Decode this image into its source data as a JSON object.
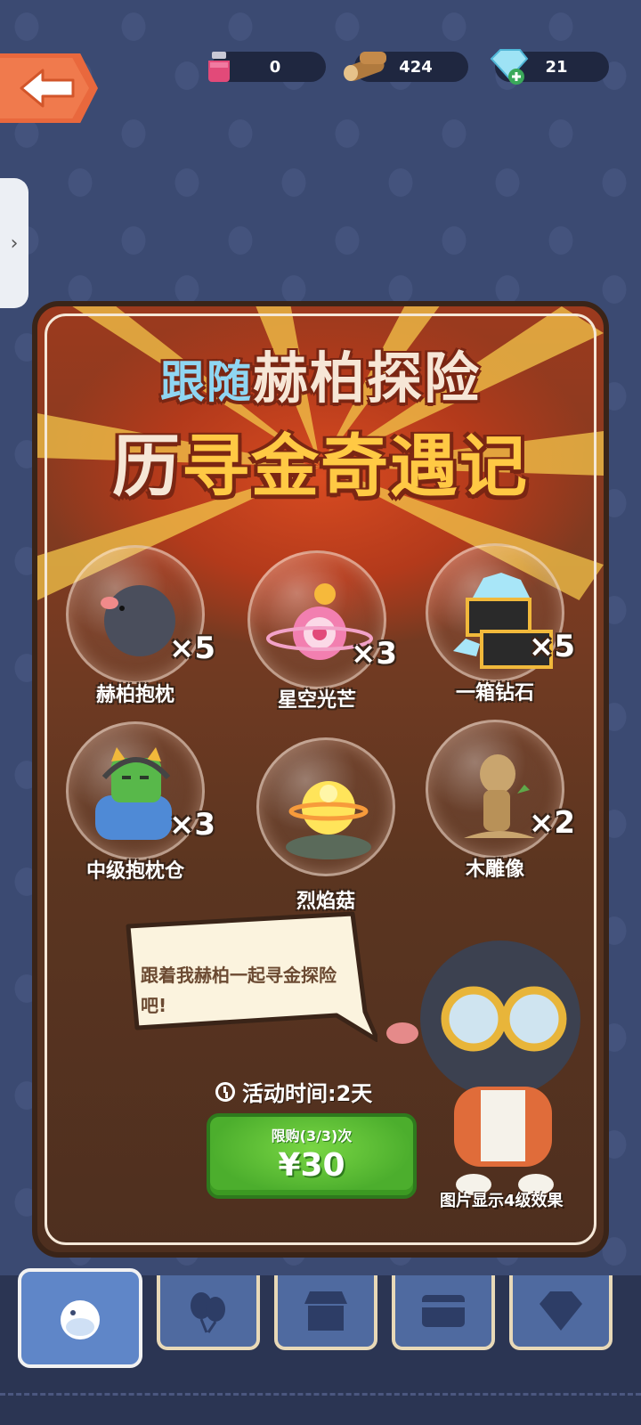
{
  "resources": [
    {
      "icon": "potion-icon",
      "value": "0"
    },
    {
      "icon": "wood-icon",
      "value": "424"
    },
    {
      "icon": "diamond-icon",
      "value": "21"
    }
  ],
  "side_tab": {
    "arrow": "›"
  },
  "banner": {
    "title_line1_blue": "跟随",
    "title_line1": "赫柏探险",
    "title_line2_light": "历",
    "title_line2": "寻金奇遇记"
  },
  "rewards": [
    {
      "name": "赫柏抱枕",
      "qty": "×5",
      "icon": "mole-pillow-icon"
    },
    {
      "name": "星空光芒",
      "qty": "×3",
      "icon": "star-light-icon"
    },
    {
      "name": "一箱钻石",
      "qty": "×5",
      "icon": "diamond-box-icon"
    },
    {
      "name": "中级抱枕仓",
      "qty": "×3",
      "icon": "pillow-pod-icon"
    },
    {
      "name": "烈焰菇",
      "qty": "",
      "icon": "flame-mushroom-icon"
    },
    {
      "name": "木雕像",
      "qty": "×2",
      "icon": "wood-statue-icon"
    }
  ],
  "speech": {
    "text": "跟着我赫柏一起寻金探险吧!"
  },
  "timer": {
    "label": "活动时间:2天"
  },
  "purchase": {
    "limit": "限购(3/3)次",
    "price": "¥30"
  },
  "note": "图片显示4级效果",
  "tabs": [
    {
      "icon": "character-icon",
      "active": true
    },
    {
      "icon": "balloons-icon",
      "active": false
    },
    {
      "icon": "shop-icon",
      "active": false
    },
    {
      "icon": "card-icon",
      "active": false
    },
    {
      "icon": "gem-icon",
      "active": false
    }
  ],
  "colors": {
    "background": "#3b4a72",
    "accent_orange": "#e9683d",
    "button_green": "#4cae2d",
    "title_gold": "#ffc944",
    "title_blue": "#8fd6f2"
  }
}
